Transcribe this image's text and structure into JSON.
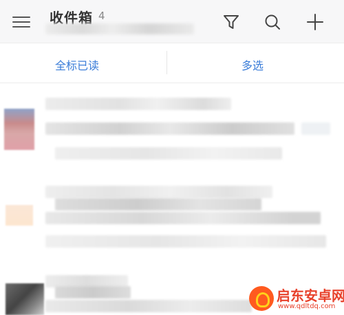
{
  "header": {
    "title": "收件箱",
    "count": "4",
    "icons": [
      "menu-icon",
      "filter-icon",
      "search-icon",
      "add-icon"
    ]
  },
  "actions": {
    "mark_all_read": "全标已读",
    "multi_select": "多选"
  },
  "colors": {
    "accent": "#3b7dd8",
    "header_bg": "#f7f7f8",
    "watermark": "#e8412b"
  },
  "watermark": {
    "title": "启东安卓网",
    "url": "www.qdltdq.com"
  }
}
